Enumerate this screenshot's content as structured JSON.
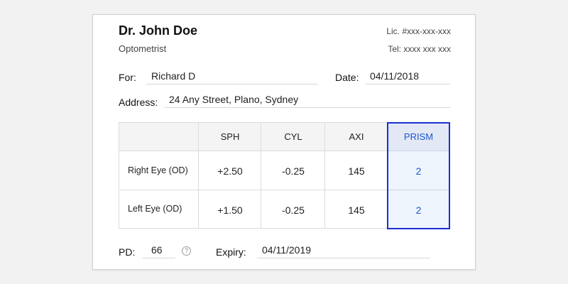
{
  "prescriber": {
    "name": "Dr. John Doe",
    "role": "Optometrist",
    "license": "Lic. #xxx-xxx-xxx",
    "phone": "Tel: xxxx xxx xxx"
  },
  "patient": {
    "for_label": "For:",
    "for_value": "Richard D",
    "date_label": "Date:",
    "date_value": "04/11/2018",
    "address_label": "Address:",
    "address_value": "24 Any Street, Plano, Sydney"
  },
  "table": {
    "headers": [
      "",
      "SPH",
      "CYL",
      "AXI",
      "PRISM"
    ],
    "rows": [
      {
        "label": "Right Eye (OD)",
        "sph": "+2.50",
        "cyl": "-0.25",
        "axi": "145",
        "prism": "2"
      },
      {
        "label": "Left Eye (OD)",
        "sph": "+1.50",
        "cyl": "-0.25",
        "axi": "145",
        "prism": "2"
      }
    ],
    "highlight_color": "#1a2fd6",
    "highlight_text_color": "#1a56d6"
  },
  "footer": {
    "pd_label": "PD:",
    "pd_value": "66",
    "help_icon": "question-circle-icon",
    "help_glyph": "?",
    "expiry_label": "Expiry:",
    "expiry_value": "04/11/2019"
  }
}
